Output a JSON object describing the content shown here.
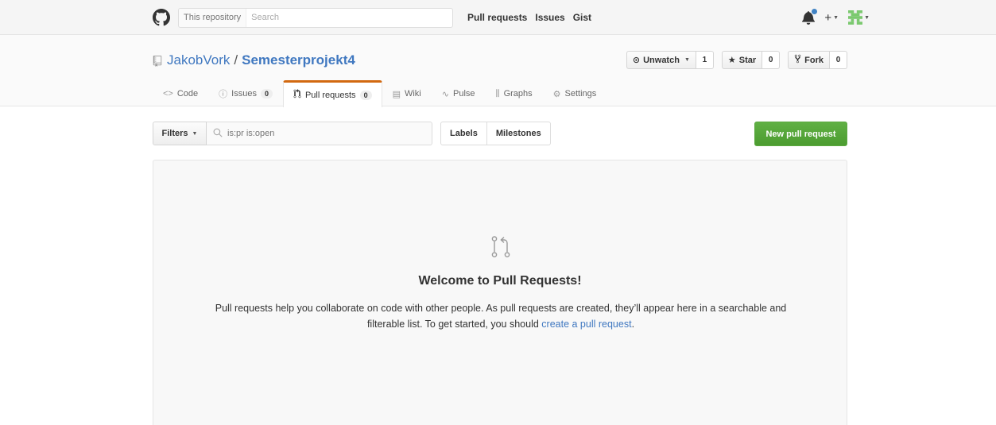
{
  "header": {
    "scope_label": "This repository",
    "search_placeholder": "Search",
    "nav": [
      "Pull requests",
      "Issues",
      "Gist"
    ]
  },
  "repo": {
    "owner": "JakobVork",
    "separator": "/",
    "name": "Semesterprojekt4",
    "watch": {
      "label": "Unwatch",
      "count": "1"
    },
    "star": {
      "label": "Star",
      "count": "0"
    },
    "fork": {
      "label": "Fork",
      "count": "0"
    }
  },
  "tabs": [
    {
      "label": "Code",
      "icon": "<>"
    },
    {
      "label": "Issues",
      "count": "0"
    },
    {
      "label": "Pull requests",
      "count": "0"
    },
    {
      "label": "Wiki"
    },
    {
      "label": "Pulse"
    },
    {
      "label": "Graphs"
    },
    {
      "label": "Settings"
    }
  ],
  "subnav": {
    "filters_label": "Filters",
    "query": "is:pr is:open",
    "labels": "Labels",
    "milestones": "Milestones",
    "new_pr": "New pull request"
  },
  "blankslate": {
    "title": "Welcome to Pull Requests!",
    "text_before": "Pull requests help you collaborate on code with other people. As pull requests are created, they’ll appear here in a searchable and filterable list. To get started, you should ",
    "link": "create a pull request",
    "text_after": "."
  },
  "colors": {
    "link": "#4078c0",
    "accent_tab": "#d26911",
    "primary_green": "#55a532"
  }
}
